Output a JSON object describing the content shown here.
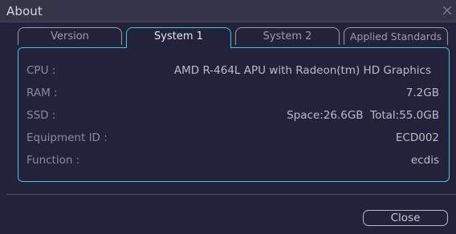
{
  "window": {
    "title": "About"
  },
  "tabs": [
    {
      "label": "Version",
      "active": false
    },
    {
      "label": "System 1",
      "active": true
    },
    {
      "label": "System 2",
      "active": false
    },
    {
      "label": "Applied Standards",
      "active": false
    }
  ],
  "system_info": {
    "cpu": {
      "label": "CPU :",
      "value": "AMD R-464L APU with Radeon(tm) HD Graphics"
    },
    "ram": {
      "label": "RAM :",
      "value": "7.2GB"
    },
    "ssd": {
      "label": "SSD :",
      "value": "Space:26.6GB  Total:55.0GB"
    },
    "equipment_id": {
      "label": "Equipment ID :",
      "value": "ECD002"
    },
    "function": {
      "label": "Function :",
      "value": "ecdis"
    }
  },
  "footer": {
    "close_label": "Close"
  },
  "colors": {
    "accent": "#3fc8d8",
    "background": "#22223a",
    "titlebar": "#353549"
  },
  "icons": {
    "window_close": "close-icon"
  }
}
